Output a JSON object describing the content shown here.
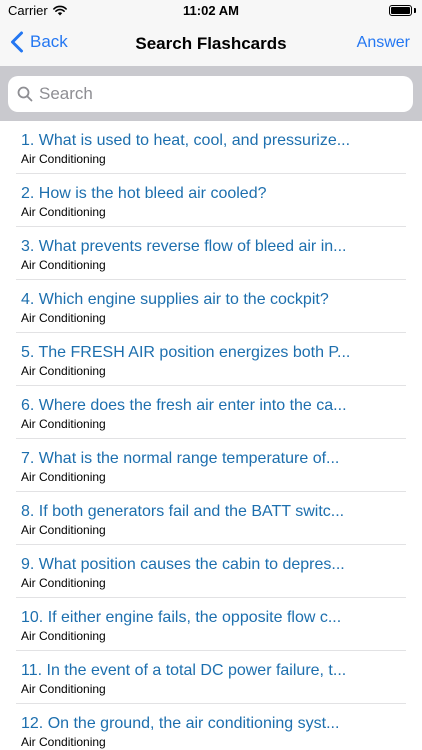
{
  "status_bar": {
    "carrier": "Carrier",
    "time": "11:02 AM"
  },
  "nav": {
    "back_label": "Back",
    "title": "Search Flashcards",
    "answer_label": "Answer"
  },
  "search": {
    "placeholder": "Search",
    "value": ""
  },
  "colors": {
    "link": "#2477f2",
    "question_text": "#1d6fae",
    "search_background": "#c9c9ce",
    "nav_background": "#f7f7f7"
  },
  "cards": [
    {
      "question": "1. What is used to heat, cool, and pressurize...",
      "category": "Air Conditioning"
    },
    {
      "question": "2. How is the hot bleed air cooled?",
      "category": "Air Conditioning"
    },
    {
      "question": "3. What prevents reverse flow of bleed air in...",
      "category": "Air Conditioning"
    },
    {
      "question": "4. Which engine supplies air to the cockpit?",
      "category": "Air Conditioning"
    },
    {
      "question": "5. The FRESH AIR position energizes both P...",
      "category": "Air Conditioning"
    },
    {
      "question": "6. Where does the fresh air enter into the ca...",
      "category": "Air Conditioning"
    },
    {
      "question": "7. What is the normal range temperature of...",
      "category": "Air Conditioning"
    },
    {
      "question": "8. If both generators fail and the BATT switc...",
      "category": "Air Conditioning"
    },
    {
      "question": "9. What position causes the cabin to depres...",
      "category": "Air Conditioning"
    },
    {
      "question": "10. If either engine fails, the opposite flow c...",
      "category": "Air Conditioning"
    },
    {
      "question": "11. In the event of a total DC power failure, t...",
      "category": "Air Conditioning"
    },
    {
      "question": "12. On the ground, the air conditioning syst...",
      "category": "Air Conditioning"
    }
  ]
}
